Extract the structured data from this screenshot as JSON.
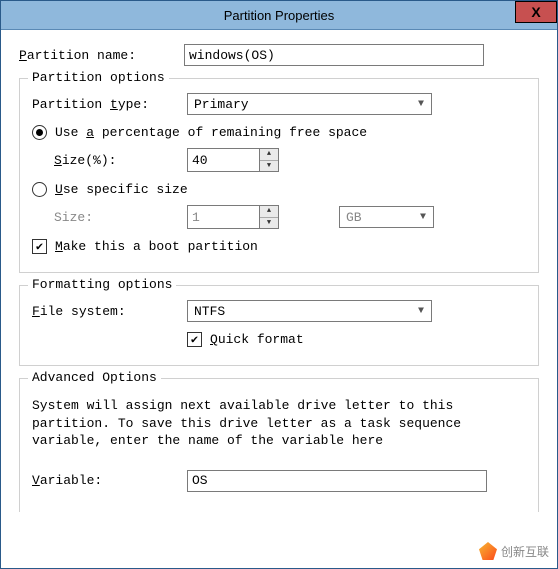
{
  "window": {
    "title": "Partition Properties",
    "close": "X"
  },
  "partition_name": {
    "label_pre": "P",
    "label_post": "artition name:",
    "value": "windows(OS)"
  },
  "partition_options": {
    "legend": "Partition options",
    "type_label_pre": "Partition ",
    "type_label_u": "t",
    "type_label_post": "ype:",
    "type_value": "Primary",
    "radio_pct_pre": "Use ",
    "radio_pct_u": "a",
    "radio_pct_post": " percentage of remaining free space",
    "radio_pct_checked": true,
    "size_pct_label_u": "S",
    "size_pct_label_post": "ize(%):",
    "size_pct_value": "40",
    "radio_fixed_u": "U",
    "radio_fixed_post": "se specific size",
    "radio_fixed_checked": false,
    "size_fixed_label": "Size:",
    "size_fixed_value": "1",
    "size_unit": "GB",
    "boot_u": "M",
    "boot_post": "ake this a boot partition",
    "boot_checked": true
  },
  "formatting": {
    "legend": "Formatting options",
    "fs_label_u": "F",
    "fs_label_post": "ile system:",
    "fs_value": "NTFS",
    "quick_u": "Q",
    "quick_post": "uick format",
    "quick_checked": true
  },
  "advanced": {
    "legend": "Advanced Options",
    "text": "System will assign next available drive letter to this partition. To save this drive letter as a task sequence variable, enter the name of the variable here",
    "var_label_u": "V",
    "var_label_post": "ariable:",
    "var_value": "OS"
  },
  "watermark": "创新互联"
}
